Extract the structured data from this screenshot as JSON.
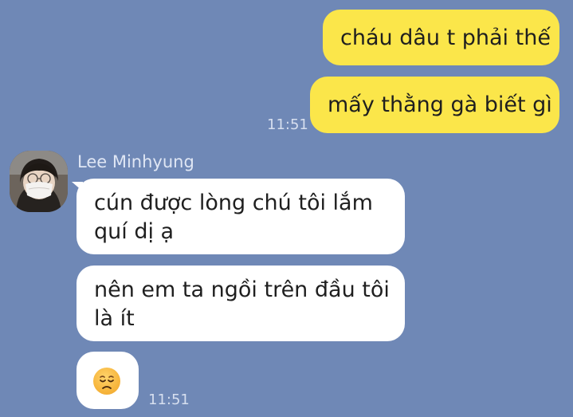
{
  "colors": {
    "background": "#6f88b6",
    "outgoing_bubble": "#fbe64a",
    "incoming_bubble": "#ffffff",
    "timestamp_text": "#d7dfef",
    "sender_name_text": "#dfe6f4"
  },
  "chat": {
    "outgoing_messages": [
      {
        "text": "cháu dâu t phải thế"
      },
      {
        "text": "mấy thằng gà biết gì"
      }
    ],
    "outgoing_timestamp": "11:51",
    "incoming": {
      "sender": "Lee Minhyung",
      "avatar_icon": "person-with-face-mask-avatar",
      "messages": [
        {
          "line1": "cún được lòng chú tôi lắm",
          "line2": "quí dị ạ"
        },
        {
          "line1": "nên em ta ngồi trên đầu tôi",
          "line2": "là ít"
        }
      ],
      "emoji_icon": "disappointed-face-emoji",
      "timestamp": "11:51"
    }
  }
}
